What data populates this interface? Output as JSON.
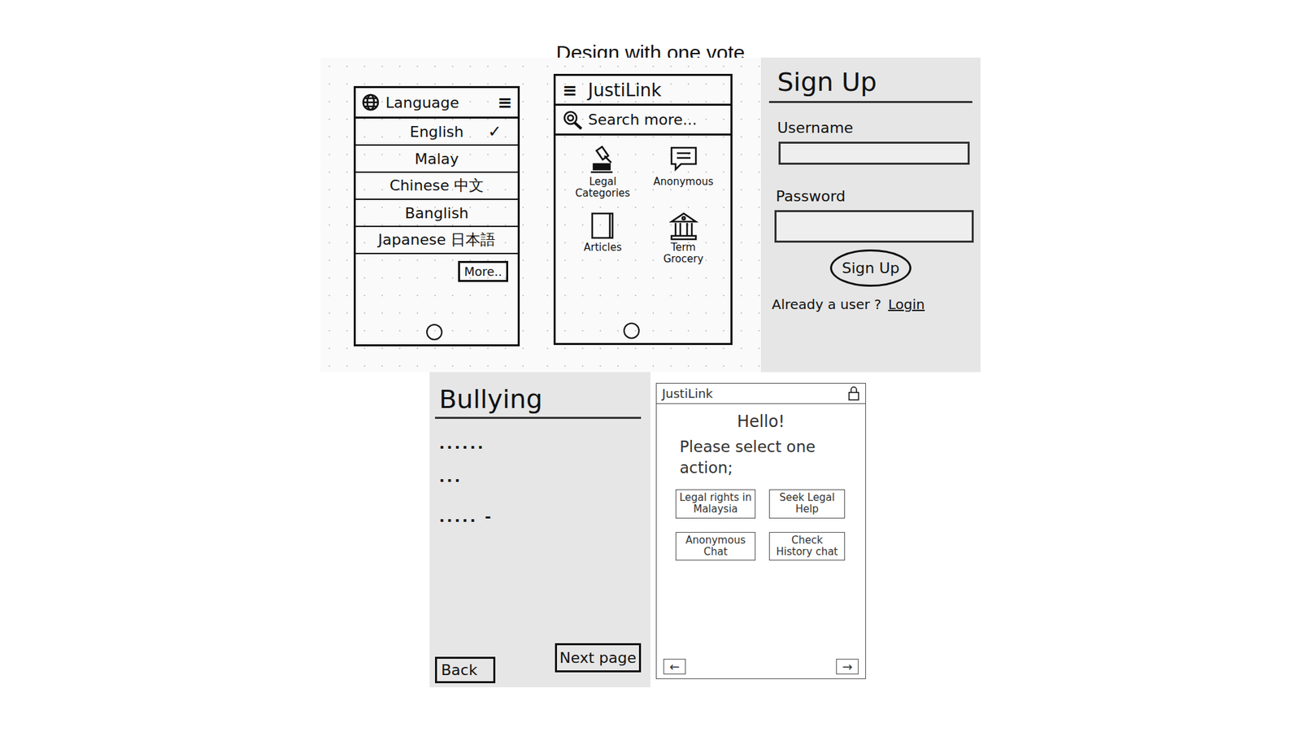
{
  "title": "Design with one vote",
  "language_screen": {
    "header": "Language",
    "menu_icon": "≡",
    "check": "✓",
    "options": [
      {
        "label": "English",
        "selected": true
      },
      {
        "label": "Malay",
        "selected": false
      },
      {
        "label": "Chinese 中文",
        "selected": false
      },
      {
        "label": "Banglish",
        "selected": false
      },
      {
        "label": "Japanese 日本語",
        "selected": false
      }
    ],
    "more_button": "More.."
  },
  "home_screen": {
    "app_title": "JustiLink",
    "menu_icon": "≡",
    "search": "Search more...",
    "tiles": [
      {
        "label": "Legal Categories",
        "kind": "gavel"
      },
      {
        "label": "Anonymous",
        "kind": "chat"
      },
      {
        "label": "Articles",
        "kind": "book"
      },
      {
        "label": "Term Grocery",
        "kind": "building"
      }
    ]
  },
  "signup_screen": {
    "header": "Sign Up",
    "username_label": "Username",
    "password_label": "Password",
    "button": "Sign Up",
    "footer_text": "Already a user ?",
    "login_link": "Login"
  },
  "article_screen": {
    "header": "Bullying",
    "lines": [
      "......",
      "...",
      "..... -"
    ],
    "back_button": "Back",
    "next_button": "Next page"
  },
  "action_screen": {
    "app_title": "JustiLink",
    "greeting": "Hello!",
    "prompt": "Please select one action;",
    "actions": [
      "Legal rights in Malaysia",
      "Seek Legal Help",
      "Anonymous Chat",
      "Check History chat"
    ],
    "back_arrow": "←",
    "next_arrow": "→"
  }
}
